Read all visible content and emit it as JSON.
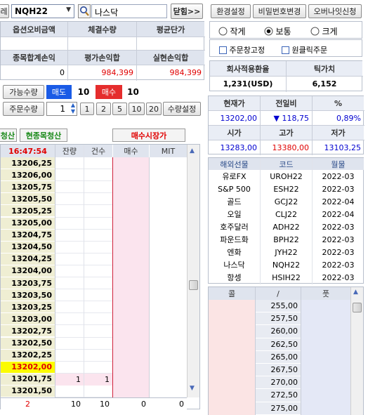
{
  "top": {
    "left_stub": "레",
    "symbol_code": "NQH22",
    "symbol_name": "나스닥",
    "close_btn": "닫힘>>",
    "settings_btn": "환경설정",
    "password_btn": "비밀번호변경",
    "overnight_btn": "오버나잇신청"
  },
  "summary": {
    "h1": "옵션오비금액",
    "h2": "체결수량",
    "h3": "평균단가",
    "h4": "종목합계손익",
    "h5": "평가손익합",
    "h6": "실현손익합",
    "v4": "0",
    "v5": "984,399",
    "v6": "984,399"
  },
  "size": {
    "small": "작게",
    "normal": "보통",
    "large": "크게",
    "selected": "보통"
  },
  "options": {
    "fixed_window": "주문창고정",
    "one_click": "원클릭주문"
  },
  "rate": {
    "label": "회사적용환율",
    "value": "1,231(USD)",
    "tick_label": "틱가치",
    "tick_value": "6,152"
  },
  "avail": {
    "label": "가능수량",
    "sell_label": "매도",
    "sell_qty": "10",
    "buy_label": "매수",
    "buy_qty": "10"
  },
  "order": {
    "label": "주문수량",
    "qty": "1",
    "q1": "1",
    "q2": "2",
    "q3": "5",
    "q4": "10",
    "q5": "20",
    "qty_setting": "수량설정"
  },
  "quote": {
    "h_price": "현재가",
    "h_change": "전일비",
    "h_pct": "%",
    "price": "13202,00",
    "change": "▼ 118,75",
    "pct": "0,89%",
    "h_open": "시가",
    "h_high": "고가",
    "h_low": "저가",
    "open": "13283,00",
    "high": "13380,00",
    "low": "13103,25"
  },
  "liquidate": {
    "left_stub": "청산",
    "current_symbol": "현종목청산",
    "market_buy": "매수시장가"
  },
  "book": {
    "time": "16:47:54",
    "col_remain": "잔량",
    "col_count": "건수",
    "col_buy": "매수",
    "col_mit": "MIT",
    "prices": [
      "13206,25",
      "13206,00",
      "13205,75",
      "13205,50",
      "13205,25",
      "13205,00",
      "13204,75",
      "13204,50",
      "13204,25",
      "13204,00",
      "13203,75",
      "13203,50",
      "13203,25",
      "13203,00",
      "13202,75",
      "13202,50",
      "13202,25",
      "13202,00",
      "13201,75",
      "13201,50"
    ],
    "current_index": 17,
    "bid_row_index": 18,
    "bid_remain": "1",
    "bid_count": "1",
    "footer": [
      "2",
      "10",
      "10",
      "0",
      "0"
    ]
  },
  "futures": {
    "h_name": "해외선물",
    "h_code": "코드",
    "h_month": "월물",
    "rows": [
      {
        "name": "유로FX",
        "code": "UROH22",
        "month": "2022-03"
      },
      {
        "name": "S&P 500",
        "code": "ESH22",
        "month": "2022-03"
      },
      {
        "name": "골드",
        "code": "GCJ22",
        "month": "2022-04"
      },
      {
        "name": "오일",
        "code": "CLJ22",
        "month": "2022-04"
      },
      {
        "name": "호주달러",
        "code": "ADH22",
        "month": "2022-03"
      },
      {
        "name": "파운드화",
        "code": "BPH22",
        "month": "2022-03"
      },
      {
        "name": "엔화",
        "code": "JYH22",
        "month": "2022-03"
      },
      {
        "name": "나스닥",
        "code": "NQH22",
        "month": "2022-03"
      },
      {
        "name": "항셍",
        "code": "HSIH22",
        "month": "2022-03"
      }
    ]
  },
  "strike": {
    "h_call": "콜",
    "h_mid": "/",
    "h_put": "풋",
    "rows": [
      "255,00",
      "257,50",
      "260,00",
      "262,50",
      "265,00",
      "267,50",
      "270,00",
      "272,50",
      "275,00"
    ]
  },
  "colors": {
    "accent_blue": "#0a4fd1",
    "sell_blue": "#1a5be6",
    "buy_red": "#e52d2d",
    "price_label_bg": "#efeed3",
    "current_price_bg": "#fbfb00",
    "buy_column_bg": "#fbe4ee"
  }
}
